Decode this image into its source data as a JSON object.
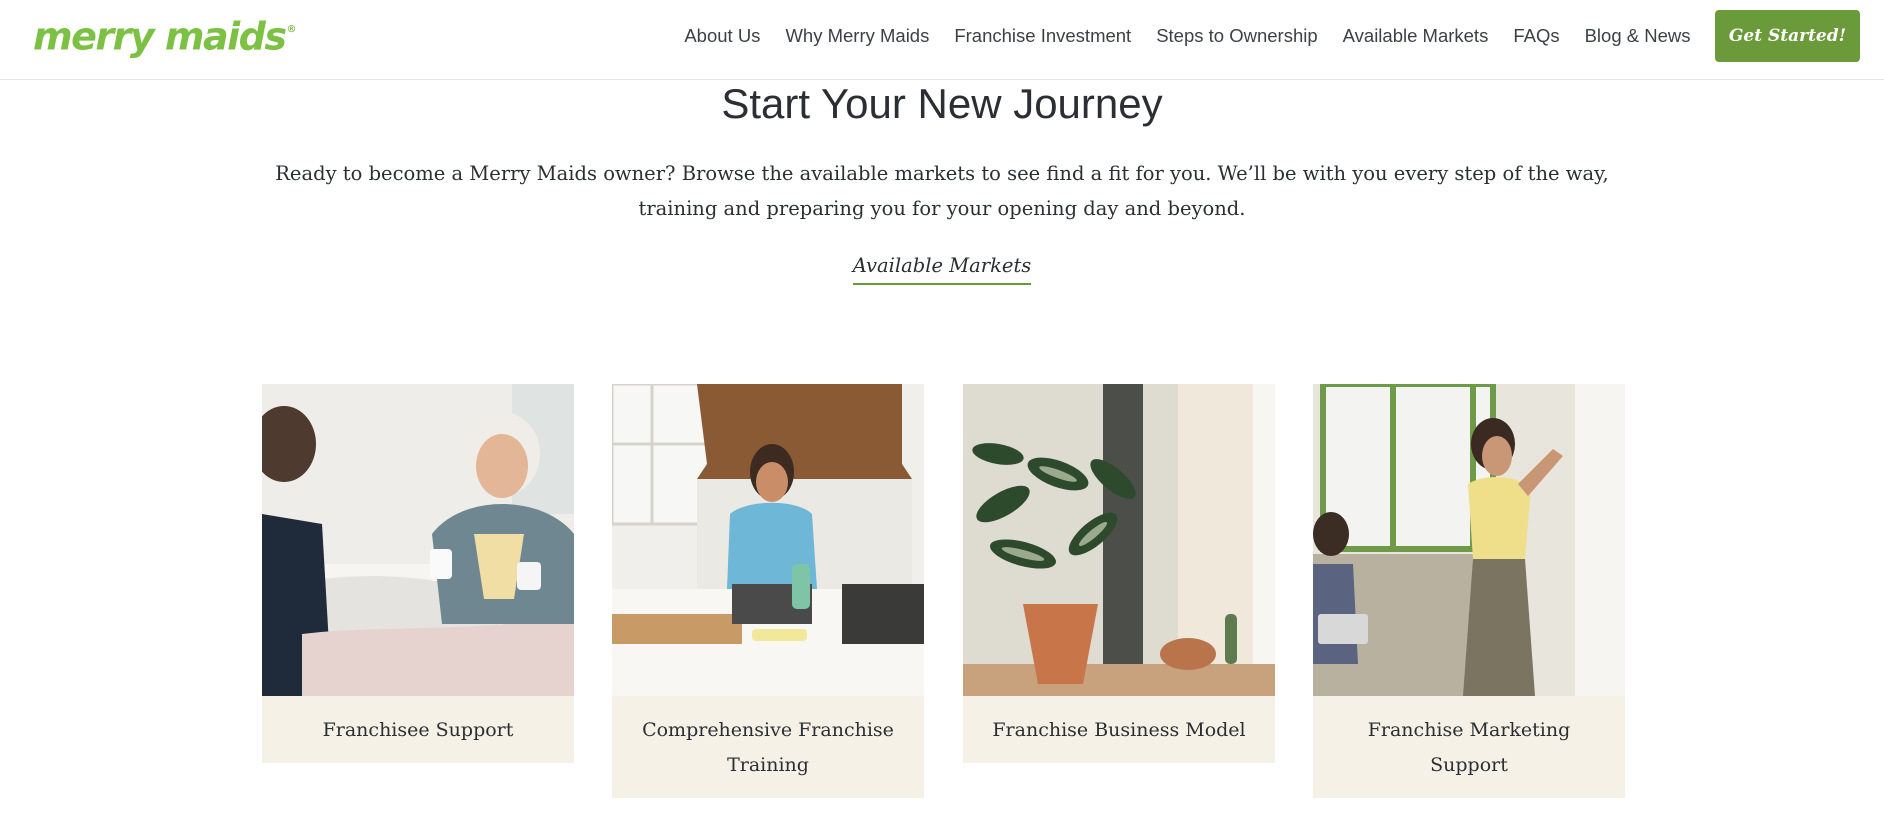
{
  "header": {
    "logo": "merry maids",
    "logo_mark": "®",
    "nav": [
      {
        "label": "About Us"
      },
      {
        "label": "Why Merry Maids"
      },
      {
        "label": "Franchise Investment"
      },
      {
        "label": "Steps to Ownership"
      },
      {
        "label": "Available Markets"
      },
      {
        "label": "FAQs"
      },
      {
        "label": "Blog & News"
      }
    ],
    "cta": "Get Started!"
  },
  "hero": {
    "title": "Start Your New Journey",
    "intro": "Ready to become a Merry Maids owner? Browse the available markets to see find a fit for you. We’ll be with you every step of the way, training and preparing you for your opening day and beyond.",
    "link": "Available Markets"
  },
  "cards": [
    {
      "caption": "Franchisee Support"
    },
    {
      "caption": "Comprehensive Franchise Training"
    },
    {
      "caption": "Franchise Business Model"
    },
    {
      "caption": "Franchise Marketing Support"
    }
  ],
  "colors": {
    "brand_green": "#7cc144",
    "button_green": "#6a9a3a",
    "caption_bg": "#f6f1e7",
    "text": "#2b2f33"
  }
}
